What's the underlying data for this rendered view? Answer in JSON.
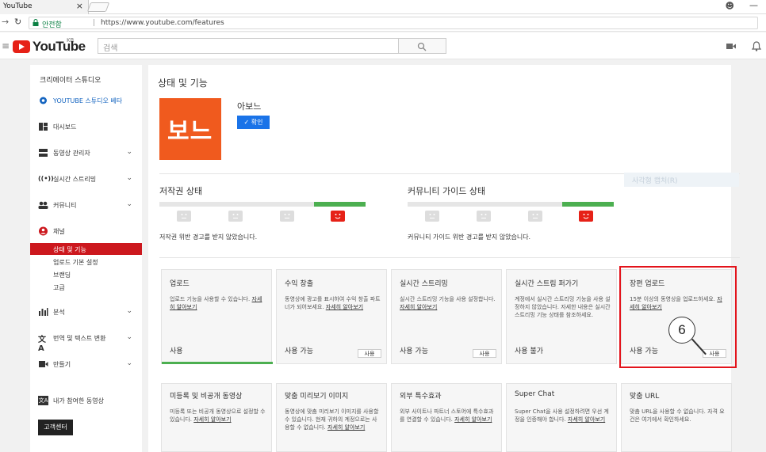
{
  "browser": {
    "tab_title": "YouTube",
    "tab_close": "×",
    "secure_label": "안전함",
    "url": "https://www.youtube.com/features"
  },
  "header": {
    "logo_text": "YouTube",
    "logo_region": "KR",
    "search_placeholder": "검색"
  },
  "sidebar": {
    "title": "크리에이터 스튜디오",
    "items": [
      {
        "label": "YOUTUBE 스튜디오 베타",
        "icon": "gear-icon"
      },
      {
        "label": "대시보드",
        "icon": "dashboard-icon"
      },
      {
        "label": "동영상 관리자",
        "icon": "video-manager-icon"
      },
      {
        "label": "실시간 스트리밍",
        "icon": "live-icon"
      },
      {
        "label": "커뮤니티",
        "icon": "community-icon"
      },
      {
        "label": "채널",
        "icon": "channel-icon"
      },
      {
        "label": "분석",
        "icon": "analytics-icon"
      },
      {
        "label": "번역 및 텍스트 변환",
        "icon": "translate-icon"
      },
      {
        "label": "만들기",
        "icon": "create-icon"
      },
      {
        "label": "내가 참여한 동영상",
        "icon": "contributions-icon"
      }
    ],
    "channel_sub": [
      "상태 및 기능",
      "업로드 기본 설정",
      "브랜딩",
      "고급"
    ],
    "help_button": "고객센터"
  },
  "main": {
    "title": "상태 및 기능",
    "channel_thumb_text": "보느",
    "channel_name": "아보느",
    "verify_button": "✓ 확인",
    "copyright": {
      "title": "저작권 상태",
      "message": "저작권 위반 경고를 받지 않았습니다."
    },
    "community": {
      "title": "커뮤니티 가이드 상태",
      "message": "커뮤니티 가이드 위반 경고를 받지 않았습니다."
    },
    "watermark": "사각형 캡처(R)",
    "cards_row1": [
      {
        "title": "업로드",
        "desc": "업로드 기능을 사용할 수 있습니다.",
        "link": "자세히 알아보기",
        "status": "사용",
        "button": ""
      },
      {
        "title": "수익 창출",
        "desc": "동영상에 광고를 표시하여 수익 창출 파트너가 되어보세요.",
        "link": "자세히 알아보기",
        "status": "사용 가능",
        "button": "사용"
      },
      {
        "title": "실시간 스트리밍",
        "desc": "실시간 스트리밍 기능을 사용 설정합니다.",
        "link": "자세히 알아보기",
        "status": "사용 가능",
        "button": "사용"
      },
      {
        "title": "실시간 스트림 퍼가기",
        "desc": "계정에서 실시간 스트리밍 기능을 사용 설정하지 않았습니다. 자세한 내용은 실시간 스트리밍 기능 상태를 참조하세요.",
        "link": "",
        "status": "사용 불가",
        "button": ""
      },
      {
        "title": "장편 업로드",
        "desc": "15분 이상의 동영상을 업로드하세요.",
        "link": "자세히 알아보기",
        "status": "사용 가능",
        "button": "사용"
      }
    ],
    "cards_row2": [
      {
        "title": "미등록 및 비공개 동영상",
        "desc": "미등록 또는 비공개 동영상으로 설정할 수 있습니다.",
        "link": "자세히 알아보기"
      },
      {
        "title": "맞춤 미리보기 이미지",
        "desc": "동영상에 맞춤 미리보기 이미지를 사용할 수 있습니다. 현재 귀하의 계정으로는 사용할 수 없습니다.",
        "link": "자세히 알아보기"
      },
      {
        "title": "외부 특수효과",
        "desc": "외부 사이트나 파트너 스토어에 특수효과를 연결할 수 있습니다.",
        "link": "자세히 알아보기"
      },
      {
        "title": "Super Chat",
        "desc": "Super Chat을 사용 설정하려면 우선 계정을 인증해야 합니다.",
        "link": "자세히 알아보기"
      },
      {
        "title": "맞춤 URL",
        "desc": "맞춤 URL을 사용할 수 없습니다. 자격 요건은 여기에서 확인하세요.",
        "link": ""
      }
    ],
    "callout_number": "6"
  }
}
